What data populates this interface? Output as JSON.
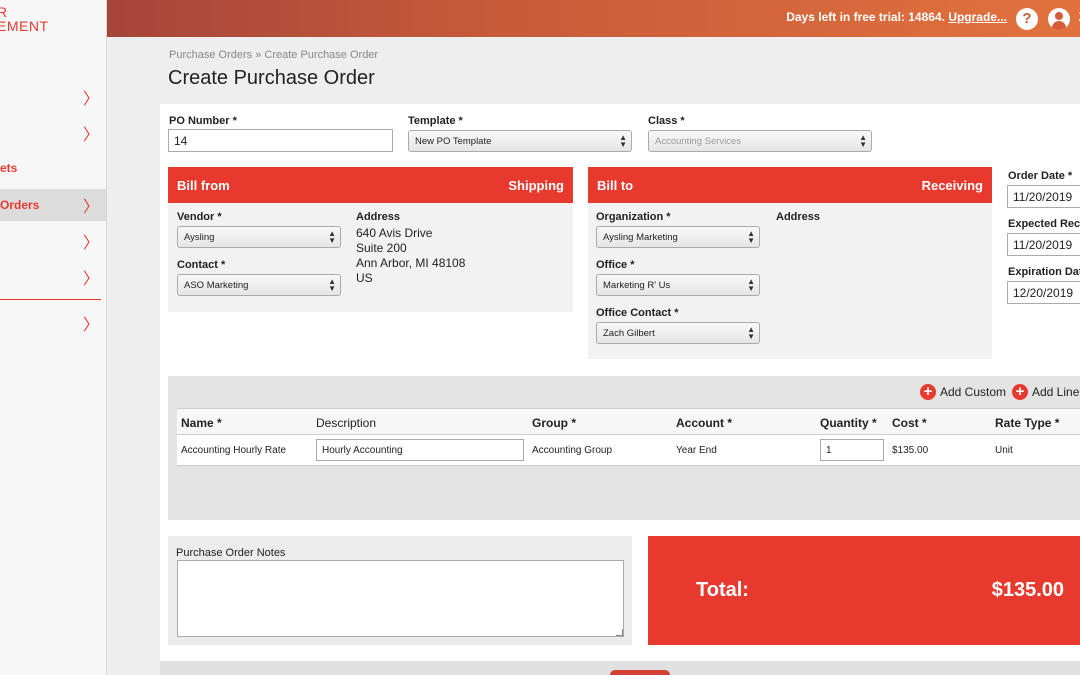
{
  "sidebar": {
    "logo_line1": "R",
    "logo_line2": "EMENT",
    "items": [
      {
        "label": "",
        "chevron": "〉"
      },
      {
        "label": "",
        "chevron": "〉"
      },
      {
        "label": "ets",
        "chevron": ""
      },
      {
        "label": "Orders",
        "chevron": "〉"
      },
      {
        "label": "",
        "chevron": "〉"
      },
      {
        "label": "",
        "chevron": "〉"
      },
      {
        "label": "",
        "chevron": "〉"
      }
    ]
  },
  "topbar": {
    "trial_text": "Days left in free trial: 14864.",
    "upgrade_link": "Upgrade...",
    "help_label": "?",
    "user_initial": "Z"
  },
  "header": {
    "breadcrumb": "Purchase Orders » Create Purchase Order",
    "title": "Create Purchase Order"
  },
  "form": {
    "po_number_label": "PO Number *",
    "po_number_value": "14",
    "template_label": "Template *",
    "template_value": "New PO Template",
    "class_label": "Class *",
    "class_value": "Accounting Services"
  },
  "bill_from": {
    "title": "Bill from",
    "right_title": "Shipping",
    "vendor_label": "Vendor *",
    "vendor_value": "Aysling",
    "contact_label": "Contact *",
    "contact_value": "ASO Marketing",
    "address_label": "Address",
    "address_lines": [
      "640 Avis Drive",
      "Suite 200",
      "Ann Arbor, MI 48108",
      "US"
    ]
  },
  "bill_to": {
    "title": "Bill to",
    "right_title": "Receiving",
    "organization_label": "Organization *",
    "organization_value": "Aysling Marketing",
    "office_label": "Office *",
    "office_value": "Marketing R' Us",
    "office_contact_label": "Office Contact *",
    "office_contact_value": "Zach Gilbert",
    "address_label": "Address"
  },
  "dates": {
    "order_date_label": "Order Date *",
    "order_date_value": "11/20/2019",
    "expected_label": "Expected Rece",
    "expected_value": "11/20/2019",
    "expiration_label": "Expiration Dat",
    "expiration_value": "12/20/2019"
  },
  "line_items": {
    "add_custom_label": "Add Custom",
    "add_line_label": "Add Line",
    "columns": [
      "Name *",
      "Description",
      "Group *",
      "Account *",
      "Quantity *",
      "Cost *",
      "Rate Type *"
    ],
    "rows": [
      {
        "name": "Accounting Hourly Rate",
        "description": "Hourly Accounting",
        "group": "Accounting Group",
        "account": "Year End",
        "quantity": "1",
        "cost": "$135.00",
        "rate_type": "Unit"
      }
    ]
  },
  "notes": {
    "label": "Purchase Order Notes",
    "value": ""
  },
  "total": {
    "label": "Total:",
    "value": "$135.00"
  },
  "colors": {
    "accent": "#e8392f",
    "topbar_start": "#a5453a",
    "topbar_end": "#e2723d"
  }
}
